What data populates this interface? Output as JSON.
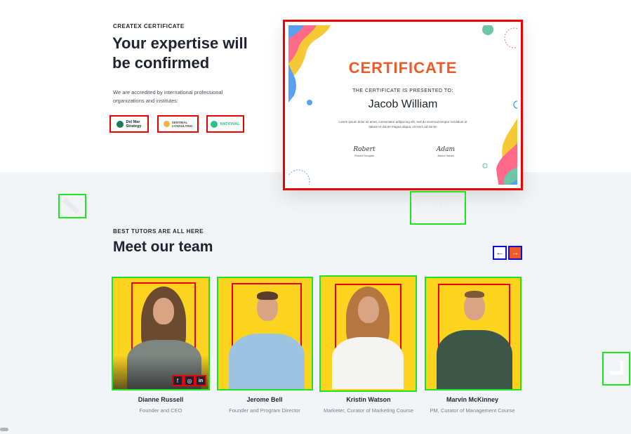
{
  "certificate_section": {
    "eyebrow": "CREATEX CERTIFICATE",
    "heading_line1": "Your expertise will",
    "heading_line2": "be confirmed",
    "description": "We are accredited by international professional organizations and institutes:",
    "logos": [
      {
        "name": "Del Mar Strategy",
        "text_line1": "Del Mar",
        "text_line2": "Strategy",
        "color": "#1a7a5a"
      },
      {
        "name": "Sentinal Consulting",
        "text_line1": "SENTINAL",
        "text_line2": "CONSULTING",
        "color": "#e8942a"
      },
      {
        "name": "National",
        "text_line1": "NATIONAL",
        "text_line2": "",
        "color": "#2fbf8a"
      }
    ],
    "certificate": {
      "title": "CERTIFICATE",
      "presented_to": "THE CERTIFICATE IS PRESENTED TO:",
      "recipient": "Jacob William",
      "lorem": "Lorem ipsum dolor sit amet, consectetur adipiscing elit, sed do eiusmod tempor incididunt ut labore et dolore magna aliqua. Ut enim ad minim",
      "signatures": [
        {
          "script": "Robert",
          "caption": "Robert Douglas"
        },
        {
          "script": "Adam",
          "caption": "Adam Harold"
        }
      ],
      "accent_color": "#f05a28"
    }
  },
  "team_section": {
    "eyebrow": "BEST TUTORS ARE ALL HERE",
    "heading": "Meet our team",
    "prev_arrow": "←",
    "next_arrow": "→",
    "members": [
      {
        "name": "Dianne Russell",
        "role": "Founder and CEO"
      },
      {
        "name": "Jerome Bell",
        "role": "Founder and Program Director"
      },
      {
        "name": "Kristin Watson",
        "role": "Marketer, Curator of Marketing Course"
      },
      {
        "name": "Marvin McKinney",
        "role": "PM, Curator of Management Course"
      }
    ],
    "social_icons": [
      "f",
      "◎",
      "in"
    ]
  },
  "colors": {
    "card_background": "#fcd31f",
    "section_background": "#f2f4f7",
    "next_button": "#f05a28"
  }
}
